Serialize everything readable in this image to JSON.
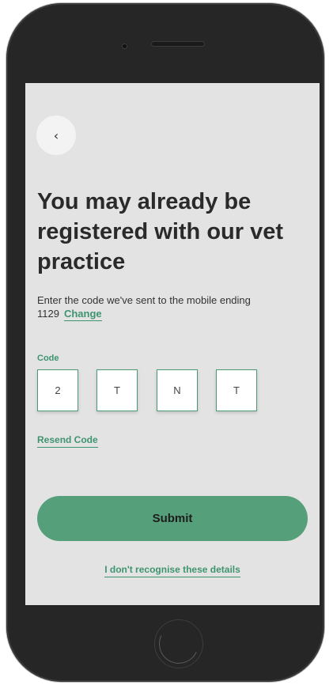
{
  "header": {
    "back_icon": "‹"
  },
  "main": {
    "title": "You may already be registered with our vet practice",
    "subtitle": "Enter the code we've sent to the mobile ending 1129",
    "change_label": "Change",
    "code_label": "Code",
    "code_digits": [
      "2",
      "T",
      "N",
      "T"
    ],
    "resend_label": "Resend Code",
    "submit_label": "Submit",
    "dont_recognise_label": "I don't recognise these details"
  },
  "colors": {
    "accent": "#3f9470",
    "button": "#55a07a",
    "screen_bg": "#e3e3e3",
    "device": "#262626"
  }
}
